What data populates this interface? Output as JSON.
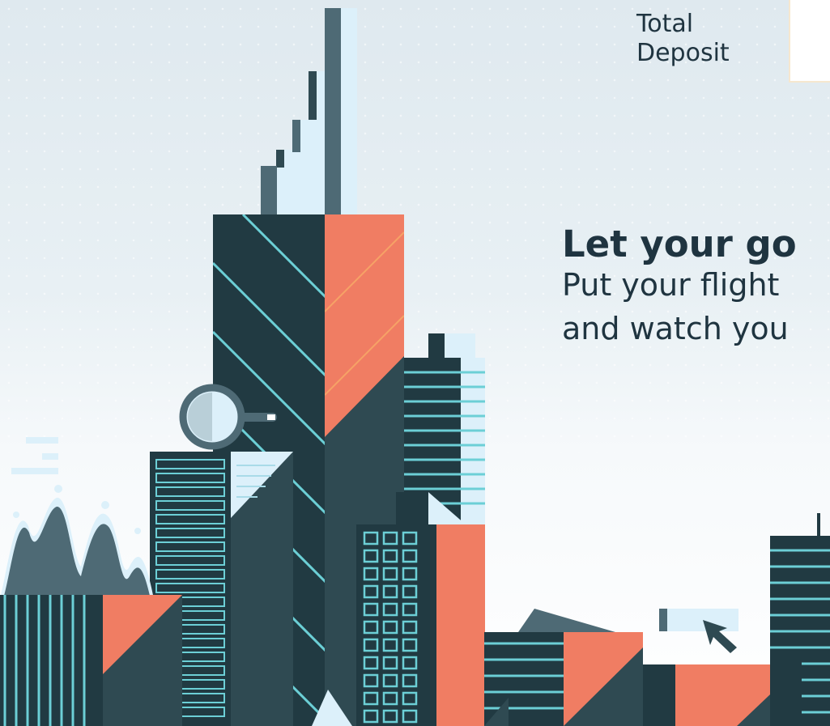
{
  "deposit": {
    "label_line1": "Total",
    "label_line2": "Deposit"
  },
  "hero": {
    "headline": "Let your go",
    "subline_line1": "Put your flight",
    "subline_line2": "and watch you"
  },
  "illustration": {
    "palette": {
      "dark": "#213a42",
      "mid": "#2f4a52",
      "slate": "#4e6a75",
      "coral": "#f07d63",
      "cyan": "#6ccfd6",
      "pale": "#dcf0fa",
      "lightblue": "#a9dbe8"
    },
    "icons": [
      "magnifier-icon",
      "cursor-arrow-icon"
    ]
  }
}
